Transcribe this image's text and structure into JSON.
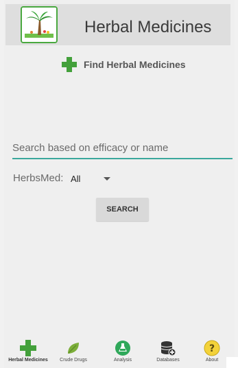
{
  "header": {
    "title": "Herbal Medicines",
    "logo_icon": "palm-tree-logo-icon"
  },
  "find_section": {
    "label": "Find Herbal Medicines",
    "icon": "green-plus-icon",
    "accent": "#43a03b"
  },
  "search": {
    "placeholder": "Search based on efficacy or name",
    "value": "",
    "underline_color": "#3aa79c"
  },
  "filter": {
    "label": "HerbsMed:",
    "selected": "All"
  },
  "search_button": {
    "label": "SEARCH"
  },
  "bottom_nav": {
    "items": [
      {
        "label": "Herbal Medicines",
        "icon": "green-plus-icon",
        "active": true
      },
      {
        "label": "Crude Drugs",
        "icon": "leaf-icon",
        "active": false
      },
      {
        "label": "Analysis",
        "icon": "flask-icon",
        "active": false
      },
      {
        "label": "Databases",
        "icon": "database-add-icon",
        "active": false
      },
      {
        "label": "About",
        "icon": "help-icon",
        "active": false
      }
    ]
  }
}
